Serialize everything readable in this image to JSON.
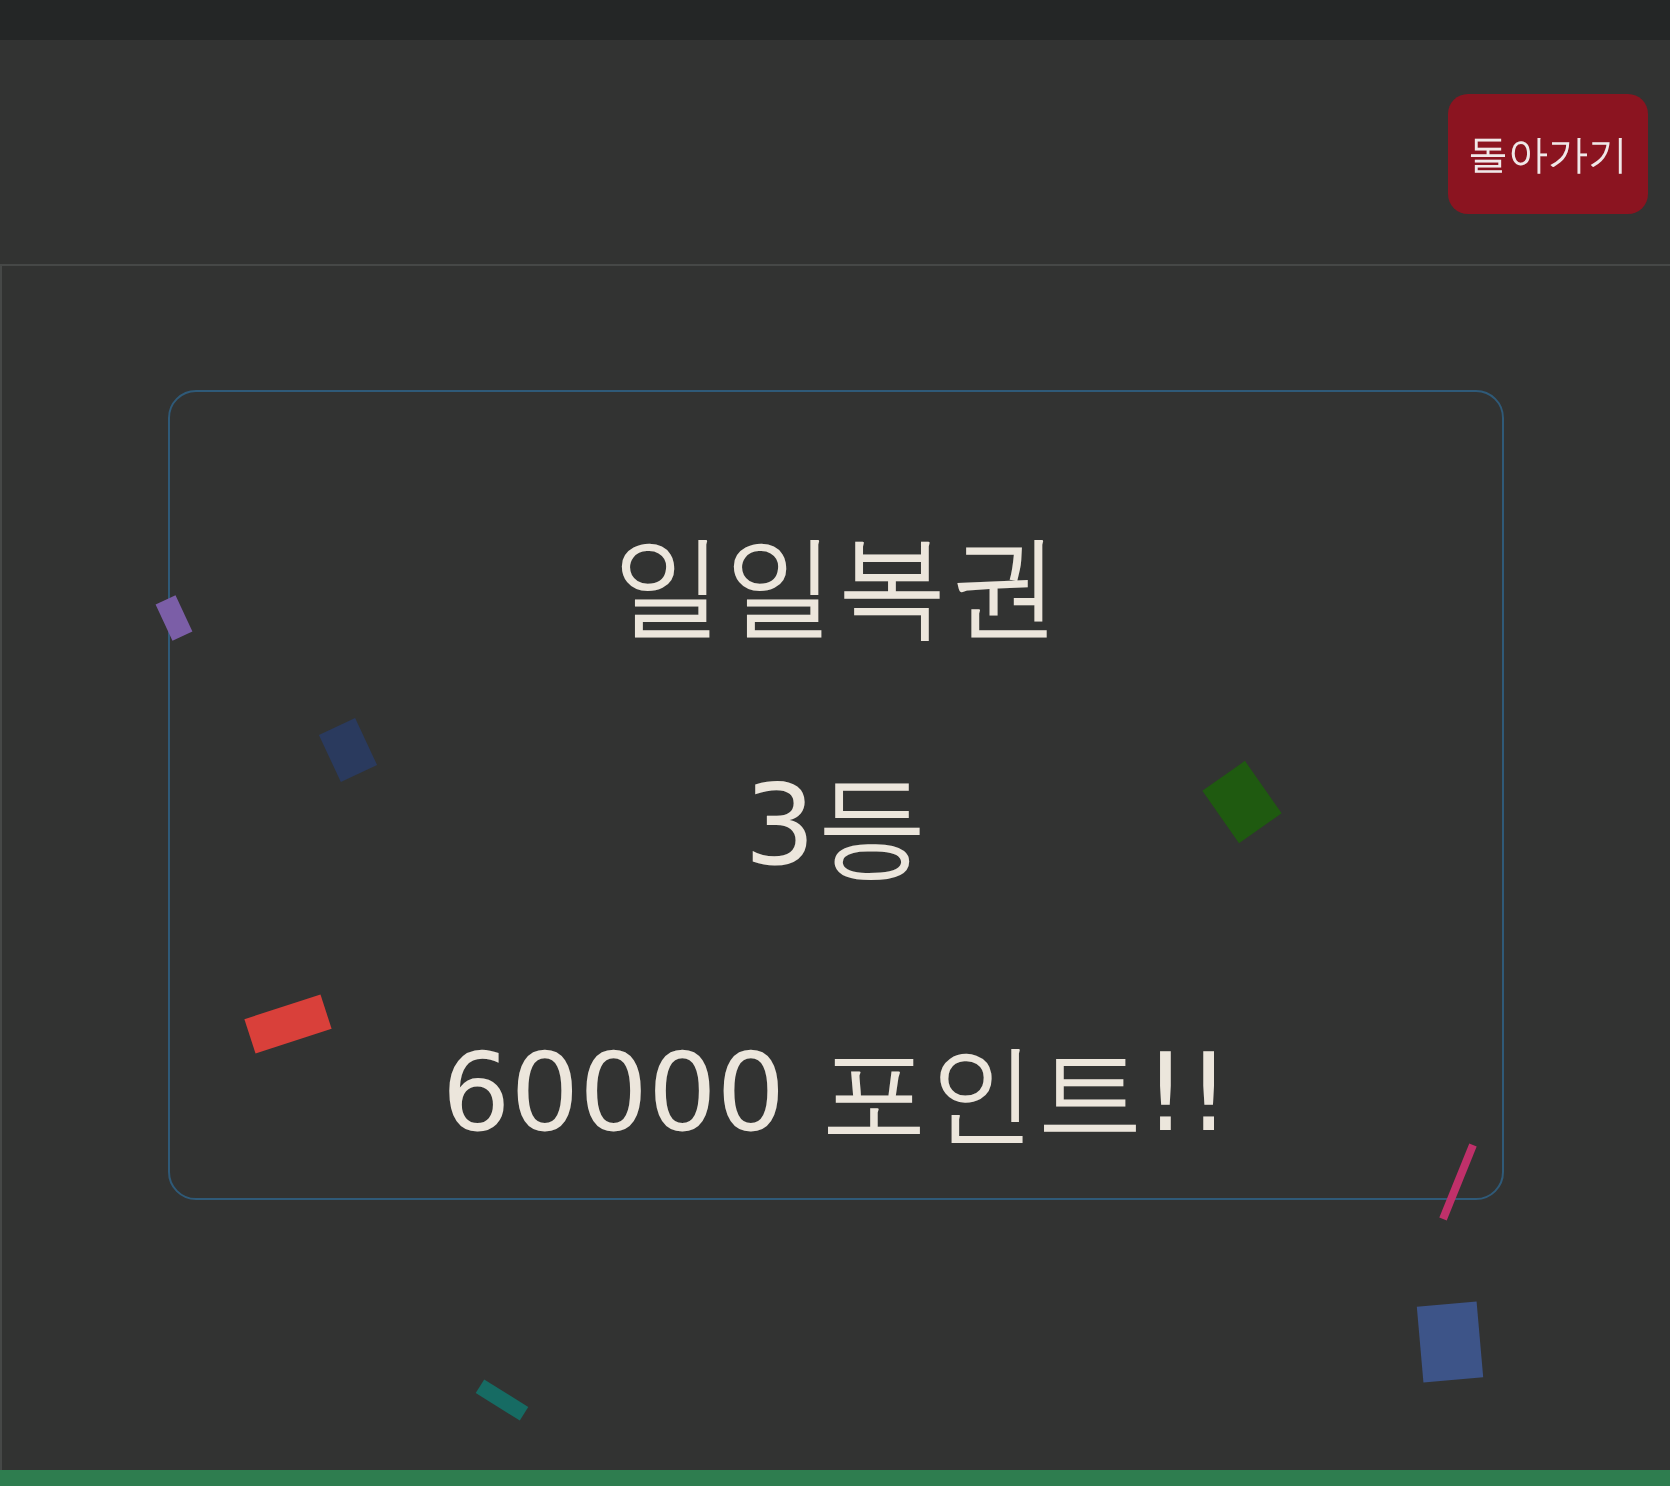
{
  "header": {
    "back_button": "돌아가기"
  },
  "result_card": {
    "title": "일일복권",
    "rank": "3등",
    "prize": "60000 포인트!!"
  }
}
